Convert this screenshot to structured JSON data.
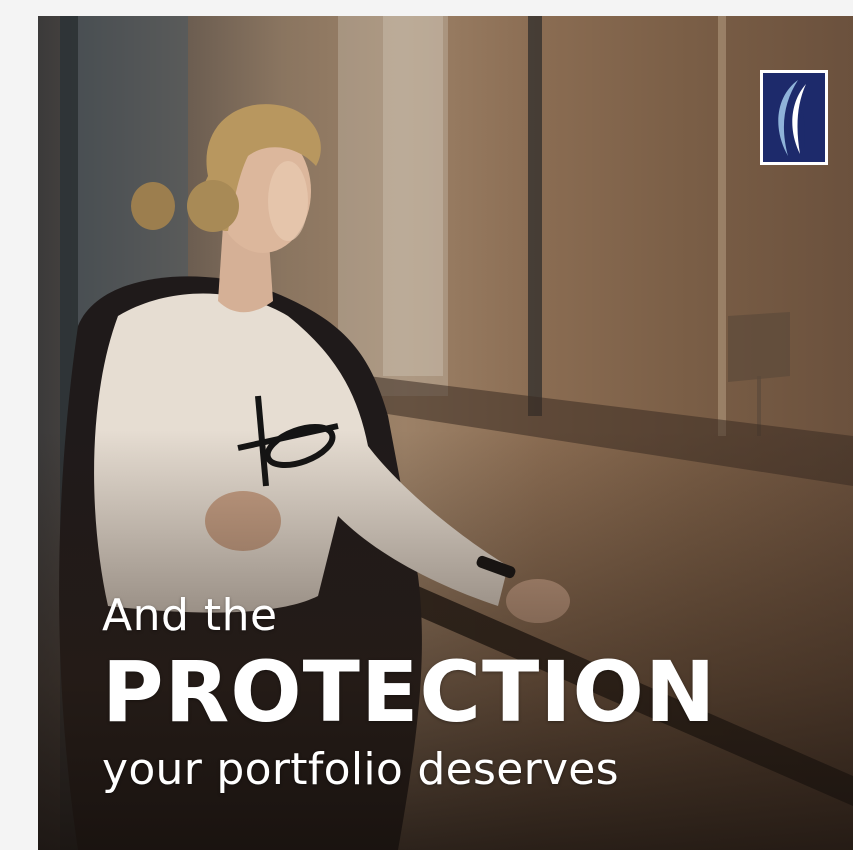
{
  "headline": {
    "line1": "And the",
    "line2": "PROTECTION",
    "line3": "your portfolio deserves"
  },
  "photo": {
    "subject": "woman-by-window-photo",
    "icon": "person-photo"
  },
  "logo": {
    "icon": "bank-logo-icon",
    "colors": {
      "background": "#1d2a6b",
      "border": "#ffffff",
      "swoosh_light": "#8fb3d9",
      "swoosh_white": "#ffffff"
    }
  },
  "colors": {
    "page_background": "#f4f4f4",
    "text": "#ffffff"
  }
}
